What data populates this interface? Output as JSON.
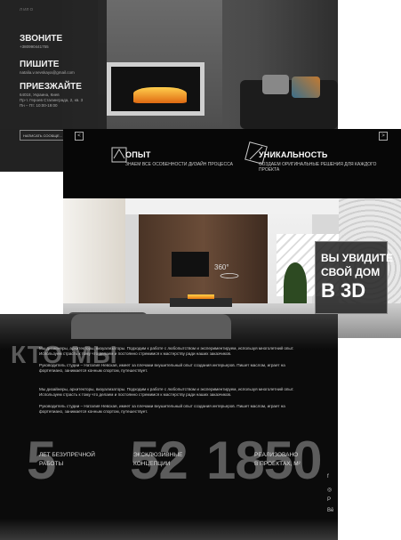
{
  "contact": {
    "top_label": "Л ИЛ О",
    "call_title": "ЗВОНИТЕ",
    "call_sub": "+380990441755",
    "write_title": "ПИШИТЕ",
    "write_sub": "natalia.v.nevskaya@gmail.com",
    "visit_title": "ПРИЕЗЖАЙТЕ",
    "visit_line1": "64018, Украина, Киев",
    "visit_line2": "Пр-т. Героев Сталинграда, 2, кв. 3",
    "visit_line3": "Пн – Пт: 10:00-19:00",
    "button_label": "НАПИСАТЬ СООБЩЕ..."
  },
  "features": {
    "prev_arrow": "<",
    "next_arrow": ">",
    "items": [
      {
        "title": "ОПЫТ",
        "sub": "ЗНАЕМ ВСЕ ОСОБЕННОСТИ ДИЗАЙН ПРОЦЕССА"
      },
      {
        "title": "УНИКАЛЬНОСТЬ",
        "sub": "СОЗДАЕМ ОРИГИНАЛЬНЫЕ РЕШЕНИЯ ДЛЯ КАЖДОГО ПРОЕКТА"
      }
    ],
    "promo_line1": "ВЫ УВИДИТЕ",
    "promo_line2": "СВОЙ ДОМ",
    "promo_line3": "В 3D",
    "badge_360": "360°"
  },
  "about": {
    "heading": "КТО МЫ",
    "paragraphs": [
      "Мы дизайнеры, архитекторы, визуализаторы. Подходим к работе с любопытством и экспериментируем, используя многолетний опыт. Используем страсть к тому что делаем и постоянно стремимся к мастерству ради наших заказчиков.",
      "Руководитель студии – Наталия Невская, имеет за плечами внушительный опыт создания интерьеров. Пишет маслом, играет на фортепиано, занимается конным спортом, путешествует.",
      "Мы дизайнеры, архитекторы, визуализаторы. Подходим к работе с любопытством и экспериментируем, используя многолетний опыт. Используем страсть к тому что делаем и постоянно стремимся к мастерству ради наших заказчиков.",
      "Руководитель студии – Наталия Невская, имеет за плечами внушительный опыт создания интерьеров. Пишет маслом, играет на фортепиано, занимается конным спортом, путешествует."
    ],
    "stats": [
      {
        "value": "5",
        "label_line1": "ЛЕТ БЕЗУПРЕЧНОЙ",
        "label_line2": "РАБОТЫ"
      },
      {
        "value": "52",
        "label_line1": "ЭКСКЛЮЗИВНЫЕ",
        "label_line2": "КОНЦЕПЦИИ"
      },
      {
        "value": "1850",
        "label_line1": "РЕАЛИЗОВАНО",
        "label_line2": "В ПРОЕКТАХ, М²"
      }
    ],
    "social": [
      "f",
      "◎",
      "P",
      "Bē"
    ]
  }
}
